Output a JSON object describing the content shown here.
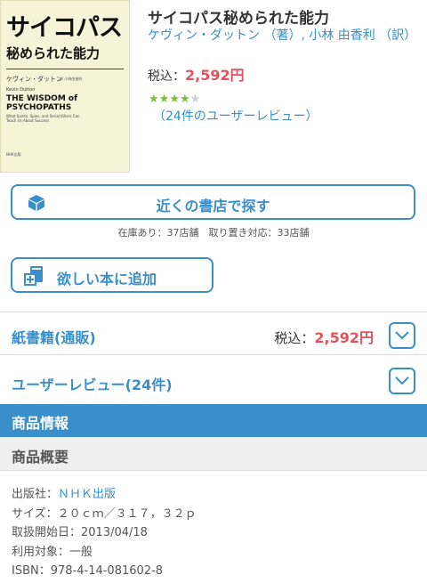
{
  "cover": {
    "title_line1": "サイコパス",
    "title_line2": "秘められた能力",
    "author_jp": "ケヴィン・ダットン",
    "translator": "訳 小林由香利",
    "author_en": "Kevin Dutton",
    "title_en": "THE WISDOM of PSYCHOPATHS",
    "subtitle_en": "What Saints, Spies, and Serial Killers Can Teach Us About Success",
    "publisher": "NHK出版"
  },
  "book": {
    "title": "サイコパス秘められた能力",
    "author": "ケヴィン・ダットン",
    "author_role": "（著）",
    "separator": ",",
    "translator": "小林 由香利",
    "translator_role": "（訳）",
    "price_label": "税込：",
    "price_value": "2,592円",
    "rating": 4,
    "rating_max": 5,
    "review_link": "（24件のユーザーレビュー）"
  },
  "actions": {
    "store_button": "近くの書店で探す",
    "stock_info": "在庫あり：37店舗　取り置き対応：33店舗",
    "wishlist_button": "欲しい本に追加"
  },
  "sections": {
    "paper_label": "紙書籍(通販)",
    "paper_price_label": "税込：",
    "paper_price_value": "2,592円",
    "reviews_label": "ユーザーレビュー(24件)",
    "product_info": "商品情報",
    "product_summary": "商品概要"
  },
  "details": {
    "publisher_label": "出版社：",
    "publisher_value": "ＮＨＫ出版",
    "size": "サイズ：２０ｃｍ／３１７，３２ｐ",
    "release": "取扱開始日：2013/04/18",
    "audience": "利用対象：一般",
    "isbn": "ISBN：978-4-14-081602-8"
  },
  "colors": {
    "accent": "#3a8ec9",
    "price": "#e8505b",
    "star": "#7cbd3a"
  }
}
